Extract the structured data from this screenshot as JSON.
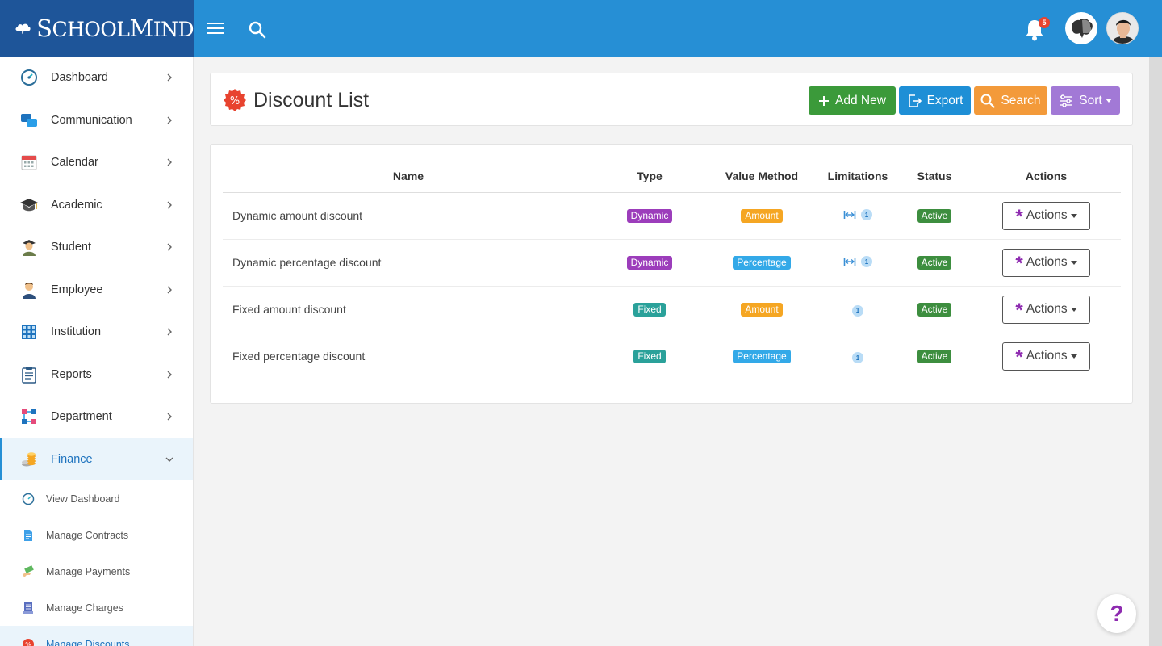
{
  "brand": {
    "name_initial_1": "S",
    "name_rest_1": "CHOOL",
    "name_initial_2": "M",
    "name_rest_2": "IND"
  },
  "topbar": {
    "notifications_count": "5"
  },
  "sidebar": {
    "items": [
      {
        "label": "Dashboard",
        "icon": "dashboard-gauge-icon"
      },
      {
        "label": "Communication",
        "icon": "chat-bubbles-icon"
      },
      {
        "label": "Calendar",
        "icon": "calendar-icon"
      },
      {
        "label": "Academic",
        "icon": "graduation-cap-icon"
      },
      {
        "label": "Student",
        "icon": "student-icon"
      },
      {
        "label": "Employee",
        "icon": "employee-icon"
      },
      {
        "label": "Institution",
        "icon": "building-grid-icon"
      },
      {
        "label": "Reports",
        "icon": "clipboard-icon"
      },
      {
        "label": "Department",
        "icon": "department-nodes-icon"
      },
      {
        "label": "Finance",
        "icon": "coins-icon"
      }
    ],
    "sub_items": [
      {
        "label": "View Dashboard",
        "icon": "gauge-icon"
      },
      {
        "label": "Manage Contracts",
        "icon": "document-icon"
      },
      {
        "label": "Manage Payments",
        "icon": "money-hand-icon"
      },
      {
        "label": "Manage Charges",
        "icon": "receipt-icon"
      },
      {
        "label": "Manage Discounts",
        "icon": "discount-badge-icon"
      }
    ]
  },
  "page": {
    "title": "Discount List",
    "buttons": {
      "add": "Add New",
      "export": "Export",
      "search": "Search",
      "sort": "Sort"
    }
  },
  "table": {
    "headers": {
      "name": "Name",
      "type": "Type",
      "value_method": "Value Method",
      "limitations": "Limitations",
      "status": "Status",
      "actions": "Actions"
    },
    "rows": [
      {
        "name": "Dynamic amount discount",
        "type": "Dynamic",
        "value_method": "Amount",
        "limit_range": true,
        "limit_count": "1",
        "status": "Active",
        "action": "Actions"
      },
      {
        "name": "Dynamic percentage discount",
        "type": "Dynamic",
        "value_method": "Percentage",
        "limit_range": true,
        "limit_count": "1",
        "status": "Active",
        "action": "Actions"
      },
      {
        "name": "Fixed amount discount",
        "type": "Fixed",
        "value_method": "Amount",
        "limit_range": false,
        "limit_count": "1",
        "status": "Active",
        "action": "Actions"
      },
      {
        "name": "Fixed percentage discount",
        "type": "Fixed",
        "value_method": "Percentage",
        "limit_range": false,
        "limit_count": "1",
        "status": "Active",
        "action": "Actions"
      }
    ]
  },
  "help": {
    "label": "?"
  },
  "colors": {
    "topbar": "#268fd5",
    "brand_bg": "#1e5599",
    "add": "#3b9a3a",
    "export": "#1e8fd6",
    "search": "#f39a3a",
    "sort": "#a279d6"
  }
}
